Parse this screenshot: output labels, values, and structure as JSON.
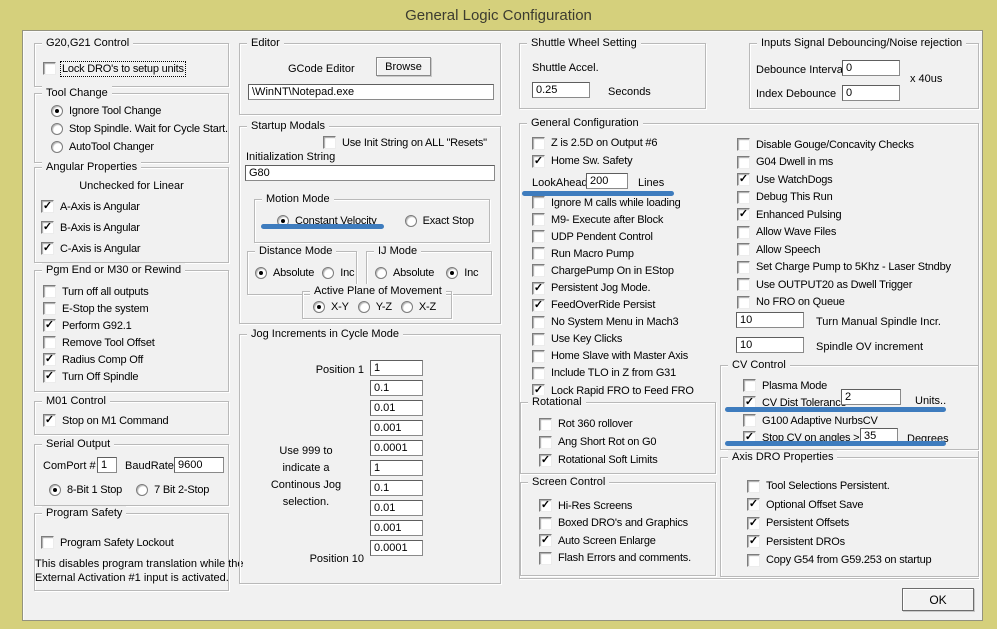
{
  "window": {
    "title": "General Logic Configuration",
    "ok_label": "OK",
    "frame_color": "#d5d07c",
    "panel_color": "#f1f1f1",
    "annotation_color": "#3e7cbe"
  },
  "groups": {
    "g20": {
      "title": "G20,G21 Control",
      "items": [
        {
          "label": "Lock DRO's to setup units",
          "checked": false,
          "focus": true
        }
      ]
    },
    "tool_change": {
      "title": "Tool Change",
      "radios": [
        {
          "label": "Ignore Tool Change",
          "selected": true
        },
        {
          "label": "Stop Spindle. Wait for Cycle Start.",
          "selected": false
        },
        {
          "label": "AutoTool Changer",
          "selected": false
        }
      ]
    },
    "angular": {
      "title": "Angular Properties",
      "note": "Unchecked for Linear",
      "items": [
        {
          "label": "A-Axis is Angular",
          "checked": true
        },
        {
          "label": "B-Axis is Angular",
          "checked": true
        },
        {
          "label": "C-Axis is Angular",
          "checked": true
        }
      ]
    },
    "pgm_end": {
      "title": "Pgm End or M30 or Rewind",
      "items": [
        {
          "label": "Turn off all outputs",
          "checked": false
        },
        {
          "label": "E-Stop the system",
          "checked": false
        },
        {
          "label": "Perform G92.1",
          "checked": true
        },
        {
          "label": "Remove Tool Offset",
          "checked": false
        },
        {
          "label": "Radius Comp Off",
          "checked": true
        },
        {
          "label": "Turn Off Spindle",
          "checked": true
        }
      ]
    },
    "m01": {
      "title": "M01 Control",
      "items": [
        {
          "label": "Stop on M1 Command",
          "checked": true
        }
      ]
    },
    "serial": {
      "title": "Serial Output",
      "comport_label": "ComPort #",
      "comport_value": "1",
      "baud_label": "BaudRate",
      "baud_value": "9600",
      "radios": [
        {
          "label": "8-Bit 1 Stop",
          "selected": true
        },
        {
          "label": "7 Bit 2-Stop",
          "selected": false
        }
      ]
    },
    "program_safety": {
      "title": "Program Safety",
      "items": [
        {
          "label": "Program Safety Lockout",
          "checked": false
        }
      ],
      "note1": "This disables program translation while the",
      "note2": "External Activation #1 input is activated."
    },
    "editor": {
      "title": "Editor",
      "field_label": "GCode Editor",
      "browse_label": "Browse",
      "path_value": "\\WinNT\\Notepad.exe"
    },
    "startup": {
      "title": "Startup Modals",
      "init_items": [
        {
          "label": "Use Init String on ALL  \"Resets\"",
          "checked": false
        }
      ],
      "init_label": "Initialization String",
      "init_value": "G80",
      "motion": {
        "title": "Motion Mode",
        "radios": [
          {
            "label": "Constant Velocity",
            "selected": true
          },
          {
            "label": "Exact Stop",
            "selected": false
          }
        ]
      },
      "distance": {
        "title": "Distance Mode",
        "radios": [
          {
            "label": "Absolute",
            "selected": true
          },
          {
            "label": "Inc",
            "selected": false
          }
        ]
      },
      "ij": {
        "title": "IJ Mode",
        "radios": [
          {
            "label": "Absolute",
            "selected": false
          },
          {
            "label": "Inc",
            "selected": true
          }
        ]
      },
      "plane": {
        "title": "Active Plane of Movement",
        "radios": [
          {
            "label": "X-Y",
            "selected": true
          },
          {
            "label": "Y-Z",
            "selected": false
          },
          {
            "label": "X-Z",
            "selected": false
          }
        ]
      }
    },
    "jog": {
      "title": "Jog Increments in Cycle Mode",
      "pos1_label": "Position 1",
      "pos10_label": "Position 10",
      "note_lines": [
        "Use 999 to",
        "indicate a",
        "Continous Jog",
        "selection."
      ],
      "values": [
        "1",
        "0.1",
        "0.01",
        "0.001",
        "0.0001",
        "1",
        "0.1",
        "0.01",
        "0.001",
        "0.0001"
      ]
    },
    "shuttle": {
      "title": "Shuttle Wheel Setting",
      "accel_label": "Shuttle Accel.",
      "accel_value": "0.25",
      "unit": "Seconds"
    },
    "debounce": {
      "title": "Inputs Signal Debouncing/Noise rejection",
      "interval_label": "Debounce Interval:",
      "interval_value": "0",
      "unit": "x 40us",
      "index_label": "Index Debounce",
      "index_value": "0"
    },
    "general": {
      "title": "General Configuration",
      "left_items1": [
        {
          "label": "Z is 2.5D on Output #6",
          "checked": false
        },
        {
          "label": "Home Sw. Safety",
          "checked": true
        }
      ],
      "lookahead": {
        "label": "LookAhead",
        "value": "200",
        "unit": "Lines"
      },
      "left_items2": [
        {
          "label": "Ignore M calls while loading",
          "checked": false
        },
        {
          "label": "M9- Execute after Block",
          "checked": false
        },
        {
          "label": "UDP Pendent Control",
          "checked": false
        },
        {
          "label": "Run Macro Pump",
          "checked": false
        },
        {
          "label": "ChargePump On in EStop",
          "checked": false
        },
        {
          "label": "Persistent Jog Mode.",
          "checked": true
        },
        {
          "label": "FeedOverRide Persist",
          "checked": true
        },
        {
          "label": "No System Menu in Mach3",
          "checked": false
        },
        {
          "label": "Use Key Clicks",
          "checked": false
        },
        {
          "label": "Home Slave with Master Axis",
          "checked": false
        },
        {
          "label": "Include TLO in Z from G31",
          "checked": false
        },
        {
          "label": "Lock Rapid FRO to Feed FRO",
          "checked": true
        }
      ],
      "rotational": {
        "title": "Rotational",
        "items": [
          {
            "label": "Rot 360 rollover",
            "checked": false
          },
          {
            "label": "Ang Short Rot on G0",
            "checked": false
          },
          {
            "label": "Rotational Soft Limits",
            "checked": true
          }
        ]
      },
      "screen": {
        "title": "Screen Control",
        "items": [
          {
            "label": "Hi-Res Screens",
            "checked": true
          },
          {
            "label": "Boxed DRO's and Graphics",
            "checked": false
          },
          {
            "label": "Auto Screen Enlarge",
            "checked": true
          },
          {
            "label": "Flash Errors and comments.",
            "checked": false
          }
        ]
      },
      "right_items": [
        {
          "label": "Disable Gouge/Concavity Checks",
          "checked": false
        },
        {
          "label": "G04 Dwell in ms",
          "checked": false
        },
        {
          "label": "Use WatchDogs",
          "checked": true
        },
        {
          "label": "Debug This Run",
          "checked": false
        },
        {
          "label": "Enhanced Pulsing",
          "checked": true
        },
        {
          "label": "Allow Wave Files",
          "checked": false
        },
        {
          "label": "Allow Speech",
          "checked": false
        },
        {
          "label": "Set Charge Pump to 5Khz  - Laser Stndby",
          "checked": false
        },
        {
          "label": "Use OUTPUT20 as Dwell Trigger",
          "checked": false
        },
        {
          "label": "No FRO on Queue",
          "checked": false
        }
      ],
      "spindle_incr": {
        "value": "10",
        "label": "Turn Manual Spindle Incr."
      },
      "spindle_ov": {
        "value": "10",
        "label": "Spindle OV increment"
      },
      "cv": {
        "title": "CV Control",
        "plasma": {
          "label": "Plasma Mode",
          "checked": false
        },
        "dist": {
          "label": "CV Dist Tolerance",
          "checked": true,
          "value": "2",
          "unit": "Units.."
        },
        "nurbs": {
          "label": "G100 Adaptive NurbsCV",
          "checked": false
        },
        "stop": {
          "label": "Stop CV on angles >",
          "checked": true,
          "value": "35",
          "unit": "Degrees"
        }
      },
      "axis_dro": {
        "title": "Axis DRO Properties",
        "items": [
          {
            "label": "Tool Selections Persistent.",
            "checked": false
          },
          {
            "label": "Optional Offset Save",
            "checked": true
          },
          {
            "label": "Persistent Offsets",
            "checked": true
          },
          {
            "label": "Persistent DROs",
            "checked": true
          },
          {
            "label": "Copy G54 from G59.253 on startup",
            "checked": false
          }
        ]
      }
    }
  }
}
